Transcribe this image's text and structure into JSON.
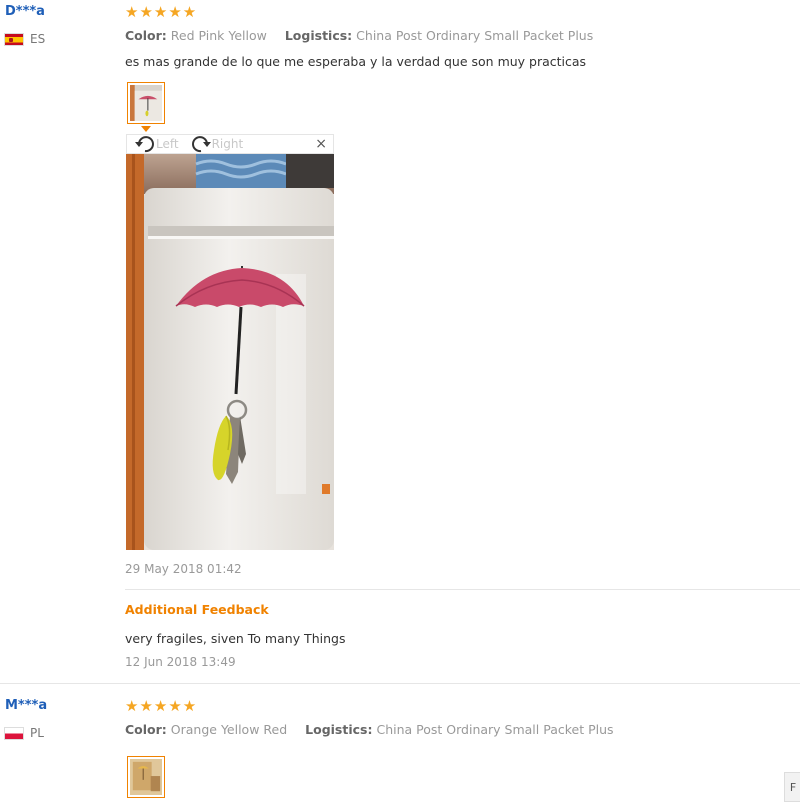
{
  "reviews": [
    {
      "user": "D***a",
      "country": "ES",
      "stars": "★★★★★",
      "color_label": "Color:",
      "color_value": "Red Pink Yellow",
      "logistics_label": "Logistics:",
      "logistics_value": "China Post Ordinary Small Packet Plus",
      "text": "es mas grande de lo que me esperaba y la verdad que son muy practicas",
      "date": "29 May 2018 01:42",
      "additional_label": "Additional Feedback",
      "additional_text": "very fragiles, siven To many Things",
      "additional_date": "12 Jun 2018 13:49"
    },
    {
      "user": "M***a",
      "country": "PL",
      "stars": "★★★★★",
      "color_label": "Color:",
      "color_value": "Orange Yellow Red",
      "logistics_label": "Logistics:",
      "logistics_value": "China Post Ordinary Small Packet Plus"
    }
  ],
  "viewer": {
    "left_label": "Left",
    "right_label": "Right",
    "close_label": "×"
  },
  "corner_button_label": "F",
  "colors": {
    "username": "#1f5fb8",
    "star": "#f5a623",
    "accent": "#f08200"
  }
}
